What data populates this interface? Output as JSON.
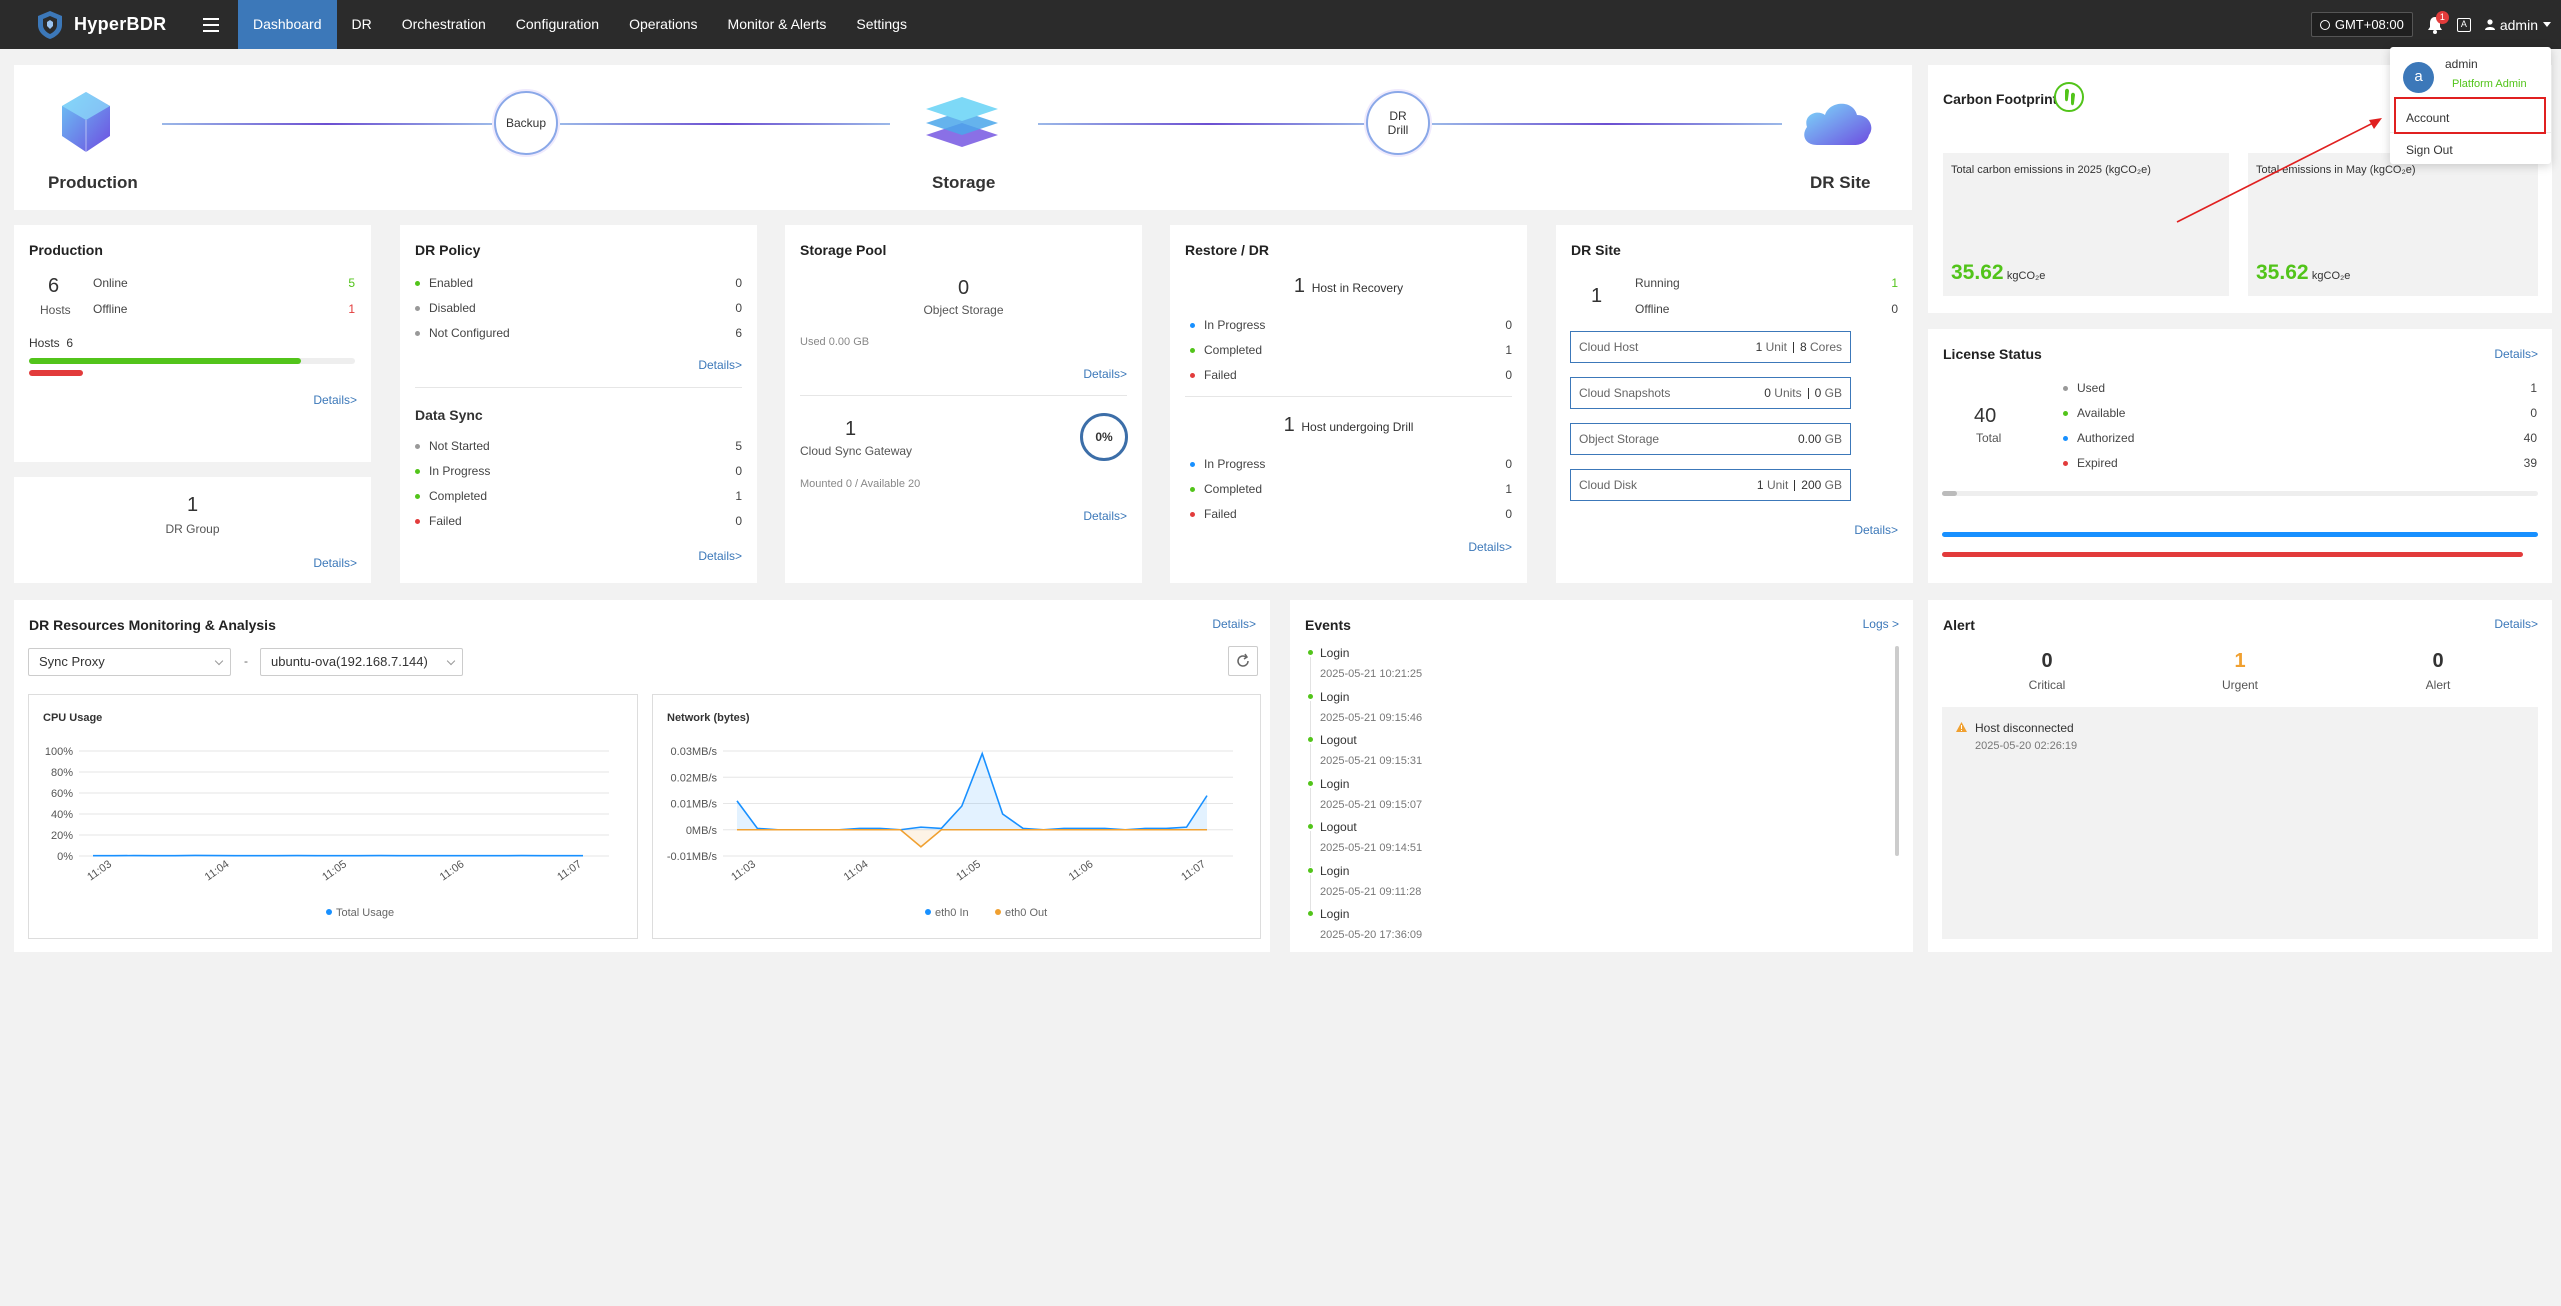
{
  "app": {
    "name": "HyperBDR"
  },
  "nav": {
    "items": [
      "Dashboard",
      "DR",
      "Orchestration",
      "Configuration",
      "Operations",
      "Monitor & Alerts",
      "Settings"
    ],
    "active": "Dashboard",
    "timezone": "GMT+08:00",
    "notification_count": "1",
    "lang_glyph": "A",
    "user": "admin"
  },
  "user_dropdown": {
    "avatar_letter": "a",
    "name": "admin",
    "role": "Platform Admin",
    "account": "Account",
    "sign_out": "Sign Out"
  },
  "flow": {
    "production": "Production",
    "backup": "Backup",
    "storage": "Storage",
    "drill_line1": "DR",
    "drill_line2": "Drill",
    "dr_site": "DR Site"
  },
  "production": {
    "title": "Production",
    "hosts_count": "6",
    "hosts_label": "Hosts",
    "online_label": "Online",
    "online_value": "5",
    "offline_label": "Offline",
    "offline_value": "1",
    "hosts_bar_label": "Hosts",
    "hosts_bar_value": "6",
    "online_fraction": 0.833,
    "offline_fraction": 0.167,
    "details": "Details>"
  },
  "dr_group": {
    "count": "1",
    "label": "DR Group",
    "details": "Details>"
  },
  "dr_policy": {
    "title": "DR Policy",
    "rows": [
      {
        "label": "Enabled",
        "value": "0",
        "color": "green"
      },
      {
        "label": "Disabled",
        "value": "0",
        "color": "gray"
      },
      {
        "label": "Not Configured",
        "value": "6",
        "color": "gray"
      }
    ],
    "details": "Details>"
  },
  "data_sync": {
    "title": "Data Sync",
    "rows": [
      {
        "label": "Not Started",
        "value": "5",
        "color": "gray"
      },
      {
        "label": "In Progress",
        "value": "0",
        "color": "green"
      },
      {
        "label": "Completed",
        "value": "1",
        "color": "green"
      },
      {
        "label": "Failed",
        "value": "0",
        "color": "red"
      }
    ],
    "details": "Details>"
  },
  "storage_pool": {
    "title": "Storage Pool",
    "object_count": "0",
    "object_label": "Object Storage",
    "used": "Used 0.00 GB",
    "details1": "Details>",
    "gateway_count": "1",
    "gateway_label": "Cloud Sync Gateway",
    "gateway_percent": "0%",
    "mounted": "Mounted 0 / Available 20",
    "details2": "Details>"
  },
  "restore_dr": {
    "title": "Restore / DR",
    "recovery_count": "1",
    "recovery_label": "Host in Recovery",
    "recovery_rows": [
      {
        "label": "In Progress",
        "value": "0",
        "color": "blue"
      },
      {
        "label": "Completed",
        "value": "1",
        "color": "green"
      },
      {
        "label": "Failed",
        "value": "0",
        "color": "red"
      }
    ],
    "drill_count": "1",
    "drill_label": "Host undergoing Drill",
    "drill_rows": [
      {
        "label": "In Progress",
        "value": "0",
        "color": "blue"
      },
      {
        "label": "Completed",
        "value": "1",
        "color": "green"
      },
      {
        "label": "Failed",
        "value": "0",
        "color": "red"
      }
    ],
    "details": "Details>"
  },
  "dr_site": {
    "title": "DR Site",
    "count": "1",
    "running_label": "Running",
    "running_value": "1",
    "offline_label": "Offline",
    "offline_value": "0",
    "cloud_host": {
      "label": "Cloud Host",
      "v1": "1",
      "u1": "Unit",
      "v2": "8",
      "u2": "Cores"
    },
    "cloud_snapshots": {
      "label": "Cloud Snapshots",
      "v1": "0",
      "u1": "Units",
      "v2": "0",
      "u2": "GB"
    },
    "object_storage": {
      "label": "Object Storage",
      "v1": "0.00",
      "u1": "GB"
    },
    "cloud_disk": {
      "label": "Cloud Disk",
      "v1": "1",
      "u1": "Unit",
      "v2": "200",
      "u2": "GB"
    },
    "details": "Details>"
  },
  "carbon": {
    "title": "Carbon Footprint",
    "year_label": "Total carbon emissions in 2025 (kgCO₂e)",
    "year_value": "35.62",
    "year_unit": "kgCO₂e",
    "month_label": "Total emissions in May (kgCO₂e)",
    "month_value": "35.62",
    "month_unit": "kgCO₂e"
  },
  "license": {
    "title": "License Status",
    "details": "Details>",
    "total": "40",
    "total_label": "Total",
    "rows": [
      {
        "label": "Used",
        "value": "1",
        "color": "gray"
      },
      {
        "label": "Available",
        "value": "0",
        "color": "green"
      },
      {
        "label": "Authorized",
        "value": "40",
        "color": "blue"
      },
      {
        "label": "Expired",
        "value": "39",
        "color": "red"
      }
    ],
    "used_fraction": 0.025,
    "authorized_fraction": 1.0,
    "expired_fraction": 0.975
  },
  "monitoring": {
    "title": "DR Resources Monitoring & Analysis",
    "details": "Details>",
    "proxy_select": "Sync Proxy",
    "separator": "-",
    "host_select": "ubuntu-ova(192.168.7.144)"
  },
  "events": {
    "title": "Events",
    "logs": "Logs >",
    "items": [
      {
        "title": "Login",
        "time": "2025-05-21 10:21:25"
      },
      {
        "title": "Login",
        "time": "2025-05-21 09:15:46"
      },
      {
        "title": "Logout",
        "time": "2025-05-21 09:15:31"
      },
      {
        "title": "Login",
        "time": "2025-05-21 09:15:07"
      },
      {
        "title": "Logout",
        "time": "2025-05-21 09:14:51"
      },
      {
        "title": "Login",
        "time": "2025-05-21 09:11:28"
      },
      {
        "title": "Login",
        "time": "2025-05-20 17:36:09"
      }
    ]
  },
  "alert": {
    "title": "Alert",
    "details": "Details>",
    "critical": "0",
    "critical_label": "Critical",
    "urgent": "1",
    "urgent_label": "Urgent",
    "alert": "0",
    "alert_label": "Alert",
    "item_title": "Host disconnected",
    "item_time": "2025-05-20 02:26:19"
  },
  "chart_data": [
    {
      "type": "line",
      "title": "CPU Usage",
      "x_ticks": [
        "11:03",
        "11:04",
        "11:05",
        "11:06",
        "11:07"
      ],
      "y_ticks": [
        "100%",
        "80%",
        "60%",
        "40%",
        "20%",
        "0%"
      ],
      "ylim": [
        0,
        100
      ],
      "series": [
        {
          "name": "Total Usage",
          "color": "#1890ff",
          "values": [
            0.3,
            0.3,
            0.4,
            0.3,
            0.3,
            0.5,
            0.4,
            0.3,
            0.3,
            0.3,
            0.4,
            0.3,
            0.3,
            0.3,
            0.4,
            0.3,
            0.3,
            0.3,
            0.3,
            0.3,
            0.3,
            0.4,
            0.3,
            0.3,
            0.3
          ]
        }
      ],
      "legend": "bottom"
    },
    {
      "type": "line",
      "title": "Network (bytes)",
      "x_ticks": [
        "11:03",
        "11:04",
        "11:05",
        "11:06",
        "11:07"
      ],
      "y_ticks": [
        "0.03MB/s",
        "0.02MB/s",
        "0.01MB/s",
        "0MB/s",
        "-0.01MB/s"
      ],
      "ylim": [
        -0.01,
        0.03
      ],
      "series": [
        {
          "name": "eth0 In",
          "color": "#1890ff",
          "values": [
            0.011,
            0.0005,
            0.0,
            0.0,
            0.0,
            0.0,
            0.0005,
            0.0005,
            0.0,
            0.001,
            0.0005,
            0.009,
            0.029,
            0.006,
            0.0005,
            0.0,
            0.0005,
            0.0005,
            0.0005,
            0.0,
            0.0005,
            0.0005,
            0.001,
            0.013
          ]
        },
        {
          "name": "eth0 Out",
          "color": "#f0a030",
          "values": [
            0.0,
            0.0,
            0.0,
            0.0,
            0.0,
            0.0,
            0.0,
            0.0,
            0.0,
            -0.0065,
            0.0,
            0.0,
            0.0,
            0.0,
            0.0,
            0.0,
            0.0,
            0.0,
            0.0,
            0.0,
            0.0,
            0.0,
            0.0,
            0.0
          ]
        }
      ],
      "legend": "bottom"
    }
  ]
}
